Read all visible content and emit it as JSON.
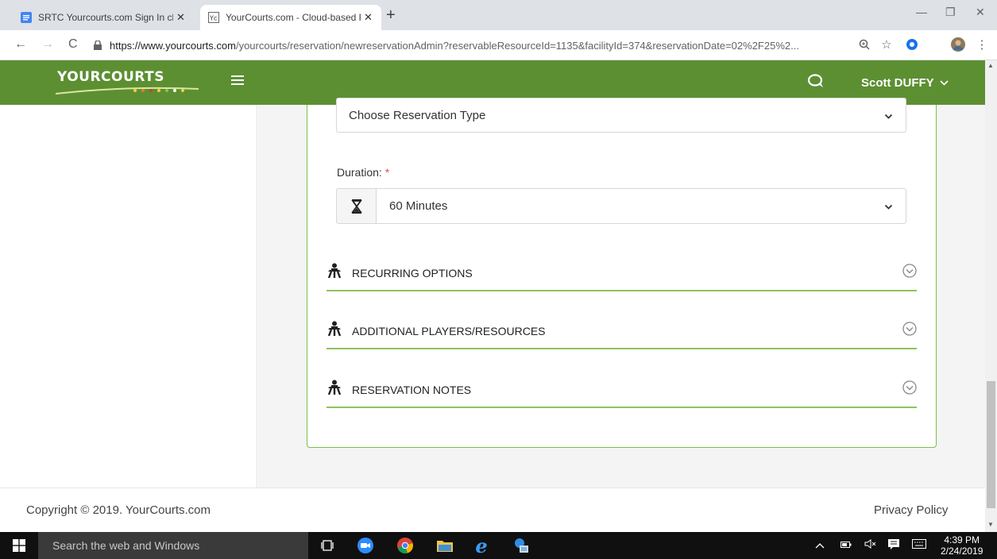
{
  "browser": {
    "tabs": [
      {
        "title": "SRTC Yourcourts.com Sign In che",
        "active": false
      },
      {
        "title": "YourCourts.com - Cloud-based R",
        "active": true
      }
    ],
    "url_host": "https://www.yourcourts.com",
    "url_path": "/yourcourts/reservation/newreservationAdmin?reservableResourceId=1135&facilityId=374&reservationDate=02%2F25%2..."
  },
  "header": {
    "logo_text": "YOURCOURTS",
    "user_name": "Scott DUFFY",
    "brand_color": "#5c8f32"
  },
  "form": {
    "reservation_type_value": "Choose Reservation Type",
    "duration_label": "Duration:",
    "required_marker": "*",
    "duration_value": "60 Minutes",
    "sections": [
      {
        "title": "RECURRING OPTIONS"
      },
      {
        "title": "ADDITIONAL PLAYERS/RESOURCES"
      },
      {
        "title": "RESERVATION NOTES"
      }
    ],
    "accent_color": "#8dc55a"
  },
  "footer": {
    "copyright": "Copyright © 2019. YourCourts.com",
    "privacy": "Privacy Policy"
  },
  "taskbar": {
    "search_placeholder": "Search the web and Windows",
    "time": "4:39 PM",
    "date": "2/24/2019"
  }
}
